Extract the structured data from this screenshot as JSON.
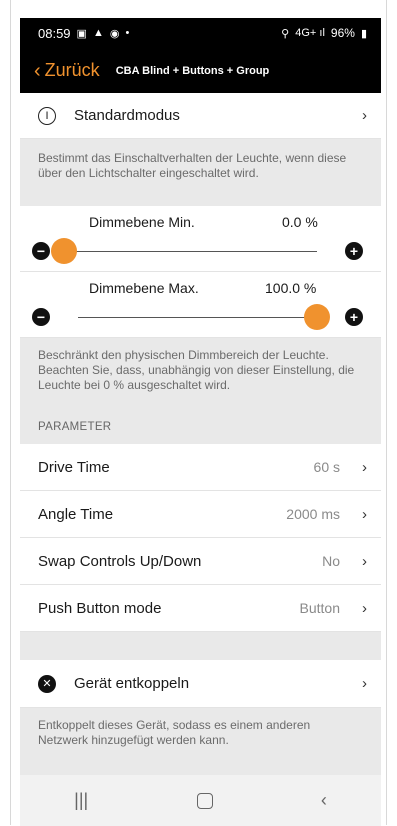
{
  "status": {
    "time": "08:59",
    "battery": "96%",
    "signal": "4G+",
    "icons": [
      "gallery-icon",
      "nav-arrow-icon",
      "chrome-icon",
      "dot-icon",
      "location-icon",
      "signal-icon",
      "battery-icon"
    ]
  },
  "nav": {
    "back_label": "Zurück",
    "title": "CBA Blind + Buttons + Group"
  },
  "standardmodus": {
    "label": "Standardmodus",
    "description": "Bestimmt das Einschaltverhalten der Leuchte, wenn diese über den Lichtschalter eingeschaltet wird."
  },
  "dim_min": {
    "label": "Dimmebene Min.",
    "value_text": "0.0 %",
    "fraction": 0.0
  },
  "dim_max": {
    "label": "Dimmebene Max.",
    "value_text": "100.0 %",
    "fraction": 1.0
  },
  "dim_description": "Beschränkt den physischen Dimmbereich der Leuchte. Beachten Sie, dass, unabhängig von dieser Einstellung, die Leuchte bei 0 % ausgeschaltet wird.",
  "parameter": {
    "header": "PARAMETER",
    "rows": [
      {
        "label": "Drive Time",
        "value": "60 s"
      },
      {
        "label": "Angle Time",
        "value": "2000 ms"
      },
      {
        "label": "Swap Controls Up/Down",
        "value": "No"
      },
      {
        "label": "Push Button mode",
        "value": "Button"
      }
    ]
  },
  "decouple": {
    "label": "Gerät entkoppeln",
    "description": "Entkoppelt dieses Gerät, sodass es einem anderen Netzwerk hinzugefügt werden kann."
  },
  "colors": {
    "accent": "#f0922e",
    "bar": "#000000",
    "section_bg": "#e9e9e9"
  }
}
